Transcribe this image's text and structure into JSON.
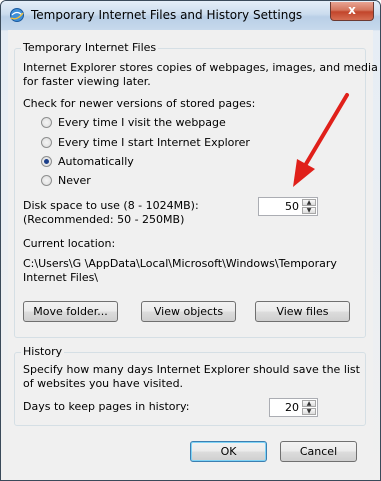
{
  "window": {
    "title": "Temporary Internet Files and History Settings",
    "close_label": "x"
  },
  "temp_files": {
    "group_title": "Temporary Internet Files",
    "description_line1": "Internet Explorer stores copies of webpages, images, and media",
    "description_line2": "for faster viewing later.",
    "check_label": "Check for newer versions of stored pages:",
    "options": [
      {
        "label": "Every time I visit the webpage",
        "checked": false
      },
      {
        "label": "Every time I start Internet Explorer",
        "checked": false
      },
      {
        "label": "Automatically",
        "checked": true
      },
      {
        "label": "Never",
        "checked": false
      }
    ],
    "disk_space_label_line1": "Disk space to use (8 - 1024MB):",
    "disk_space_label_line2": "(Recommended: 50 - 250MB)",
    "disk_space_value": "50",
    "current_location_label": "Current location:",
    "location_line1": "C:\\Users\\G       \\AppData\\Local\\Microsoft\\Windows\\Temporary",
    "location_line2": "Internet Files\\",
    "buttons": {
      "move_folder": "Move folder...",
      "view_objects": "View objects",
      "view_files": "View files"
    }
  },
  "history": {
    "group_title": "History",
    "description_line1": "Specify how many days Internet Explorer should save the list",
    "description_line2": "of websites you have visited.",
    "days_label": "Days to keep pages in history:",
    "days_value": "20"
  },
  "footer": {
    "ok": "OK",
    "cancel": "Cancel"
  },
  "colors": {
    "annotation_arrow": "#e0201a",
    "title_bar": "#c7d9ec",
    "close_button": "#c2452b"
  }
}
